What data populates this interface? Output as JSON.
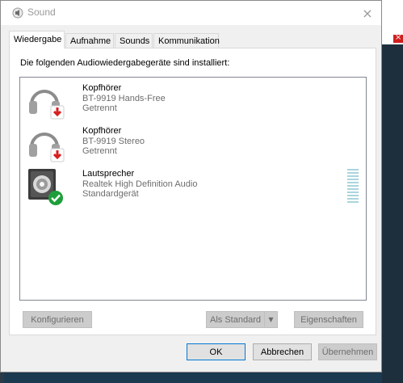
{
  "window": {
    "title": "Sound",
    "close_glyph": "×"
  },
  "tabs": [
    {
      "label": "Wiedergabe",
      "active": true
    },
    {
      "label": "Aufnahme",
      "active": false
    },
    {
      "label": "Sounds",
      "active": false
    },
    {
      "label": "Kommunikation",
      "active": false
    }
  ],
  "panel": {
    "heading": "Die folgenden Audiowiedergabegeräte sind installiert:"
  },
  "devices": [
    {
      "icon": "headphones-icon",
      "status_icon": "disconnected-arrow-icon",
      "name": "Kopfhörer",
      "description": "BT-9919 Hands-Free",
      "status": "Getrennt"
    },
    {
      "icon": "headphones-icon",
      "status_icon": "disconnected-arrow-icon",
      "name": "Kopfhörer",
      "description": "BT-9919 Stereo",
      "status": "Getrennt"
    },
    {
      "icon": "speaker-icon",
      "status_icon": "default-check-icon",
      "name": "Lautsprecher",
      "description": "Realtek High Definition Audio",
      "status": "Standardgerät"
    }
  ],
  "buttons": {
    "configure": "Konfigurieren",
    "set_default": "Als Standard",
    "properties": "Eigenschaften",
    "ok": "OK",
    "cancel": "Abbrechen",
    "apply": "Übernehmen"
  },
  "colors": {
    "accent": "#0078d7",
    "check_green": "#1e9e3a",
    "disconnect_red": "#d71f1f",
    "level_meter": "#a9d5de"
  }
}
